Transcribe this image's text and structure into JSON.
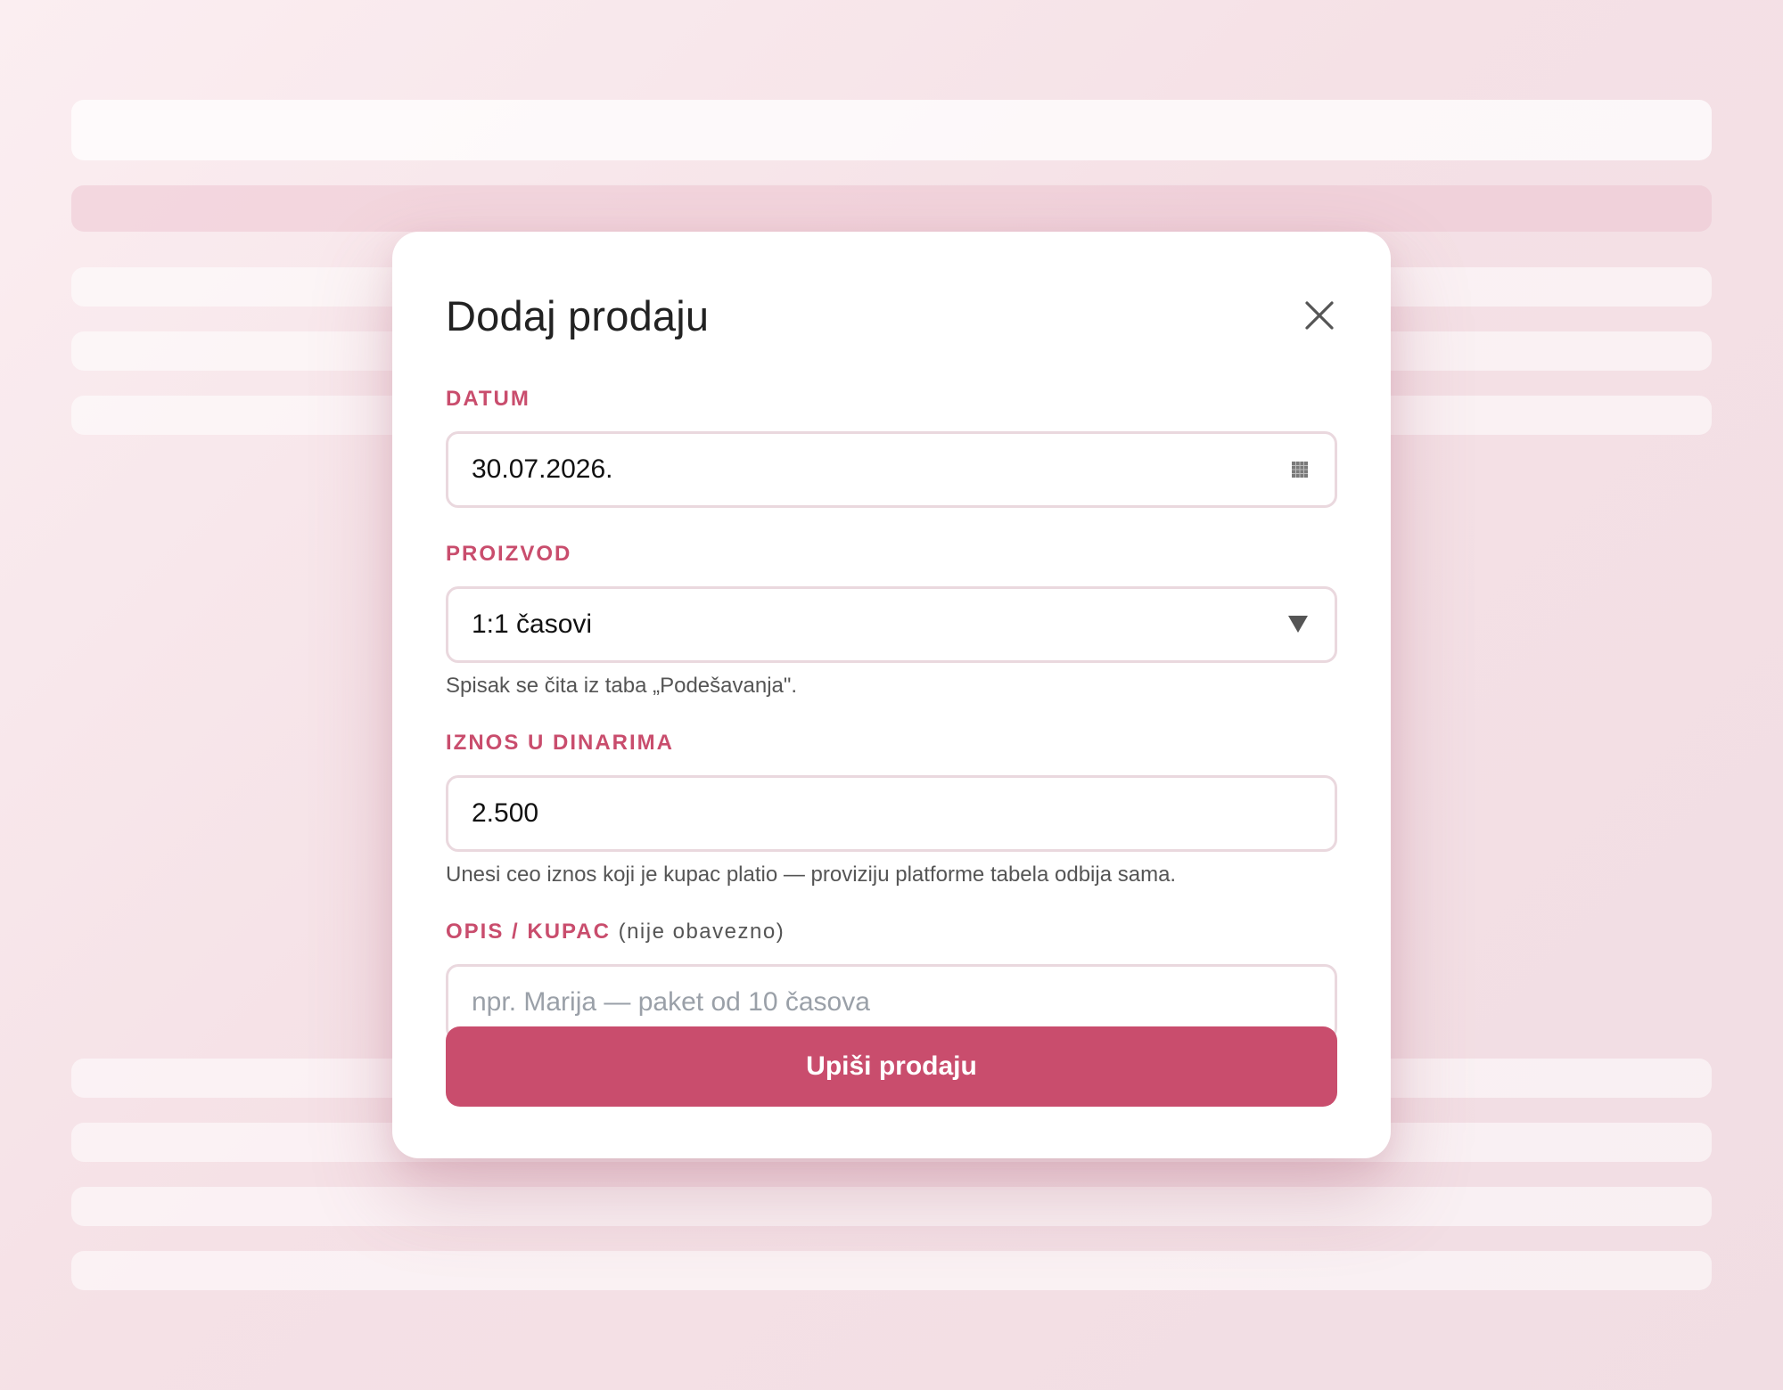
{
  "modal": {
    "title": "Dodaj prodaju",
    "close_icon": "close-icon"
  },
  "fields": {
    "datum": {
      "label": "DATUM",
      "value": "30.07.2026.",
      "icon": "calendar-icon"
    },
    "proizvod": {
      "label": "PROIZVOD",
      "selected": "1:1 časovi",
      "icon": "dropdown-triangle-icon",
      "hint": "Spisak se čita iz taba „Podešavanja\"."
    },
    "iznos": {
      "label": "IZNOS U DINARIMA",
      "value": "2.500",
      "hint": "Unesi ceo iznos koji je kupac platio — proviziju platforme tabela odbija sama."
    },
    "opis": {
      "label": "OPIS / KUPAC",
      "optional": "(nije obavezno)",
      "value": "",
      "placeholder": "npr. Marija — paket od 10 časova"
    }
  },
  "submit_label": "Upiši prodaju",
  "colors": {
    "accent": "#c94d6d",
    "border": "#ead8de",
    "background": "#f5e1e6"
  }
}
